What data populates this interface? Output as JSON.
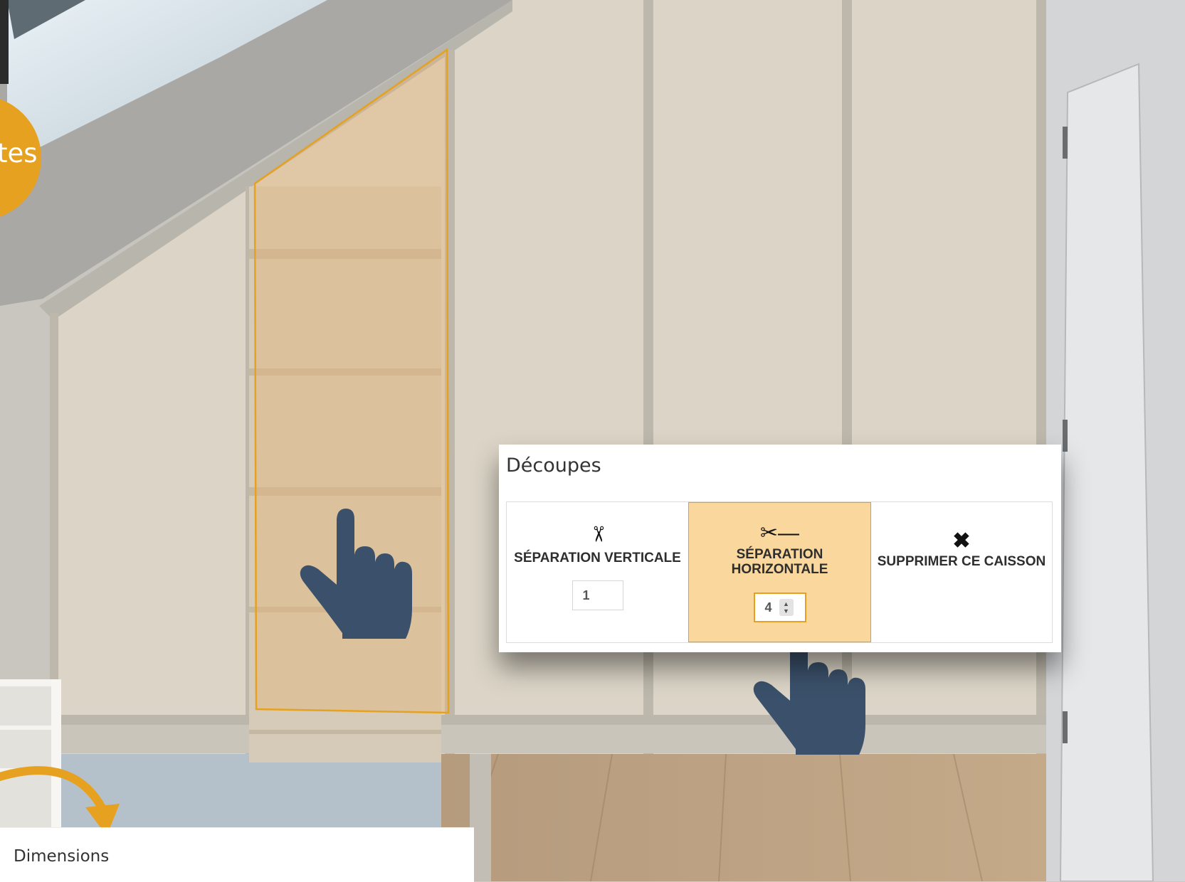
{
  "decoupes": {
    "title": "Découpes",
    "vertical": {
      "label": "SÉPARATION VERTICALE",
      "icon": "scissors-vertical-icon",
      "value": "1"
    },
    "horizontal": {
      "label_line1": "SÉPARATION",
      "label_line2": "HORIZONTALE",
      "icon": "scissors-horizontal-icon",
      "value": "4",
      "selected": true
    },
    "delete": {
      "label": "SUPPRIMER CE CAISSON",
      "icon": "close-x-icon"
    }
  },
  "side_badge": {
    "label": "tes"
  },
  "bottom_panel": {
    "title": "Dimensions"
  },
  "colors": {
    "accent": "#e5a11f",
    "selected_bg": "#fad79d",
    "highlight_fill": "#ddc4a3",
    "hand_pointer": "#3b516b"
  },
  "horizontal_cuts": 4
}
